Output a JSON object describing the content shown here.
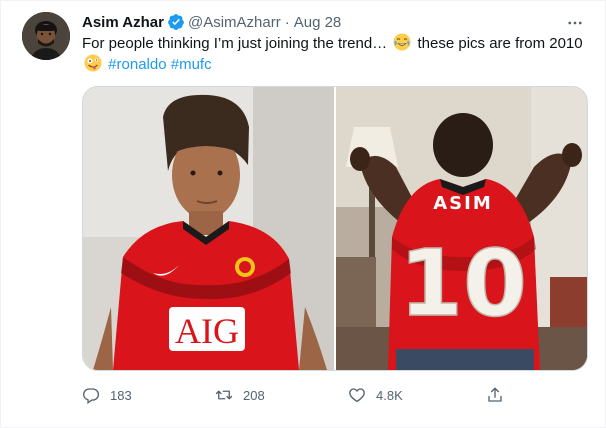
{
  "tweet": {
    "author_name": "Asim Azhar",
    "handle": "@AsimAzharr",
    "separator": "·",
    "date": "Aug 28",
    "verified": true,
    "text_line1": "For people thinking I’m just joining the trend…",
    "text_line1_end": "these pics are from 2010",
    "hashtags": [
      "#ronaldo",
      "#mufc"
    ],
    "emojis": [
      "face-with-tears-of-joy",
      "zany-face"
    ]
  },
  "media": {
    "left_photo": {
      "jersey_sponsor": "AIG"
    },
    "right_photo": {
      "jersey_name": "ASIM",
      "jersey_number": "10"
    }
  },
  "actions": {
    "reply_count": "183",
    "retweet_count": "208",
    "like_count": "4.8K"
  },
  "colors": {
    "accent": "#1d9bf0",
    "secondary_text": "#536471",
    "jersey_red": "#d9141a"
  }
}
